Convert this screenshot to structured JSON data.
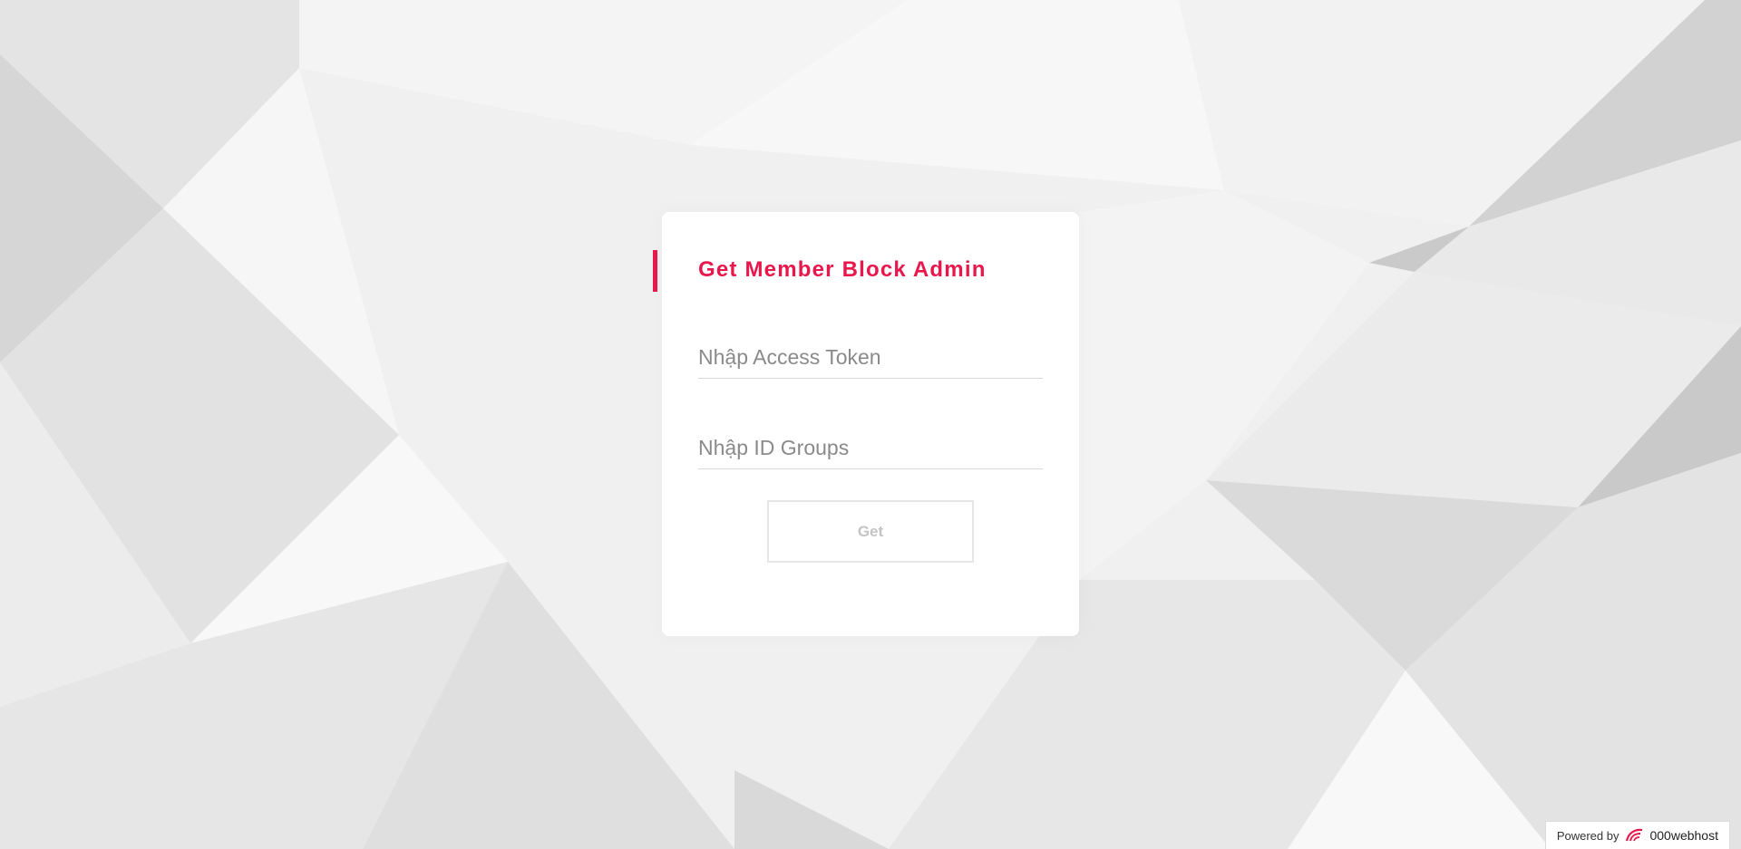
{
  "form": {
    "title": "Get Member Block Admin",
    "token_placeholder": "Nhập Access Token",
    "groups_placeholder": "Nhập ID Groups",
    "token_value": "",
    "groups_value": "",
    "submit_label": "Get"
  },
  "footer": {
    "powered_label": "Powered by",
    "brand": "000webhost",
    "logo_icon": "webhost-logo-icon"
  },
  "colors": {
    "accent": "#e8174c",
    "background": "#efefef",
    "card": "#ffffff"
  }
}
